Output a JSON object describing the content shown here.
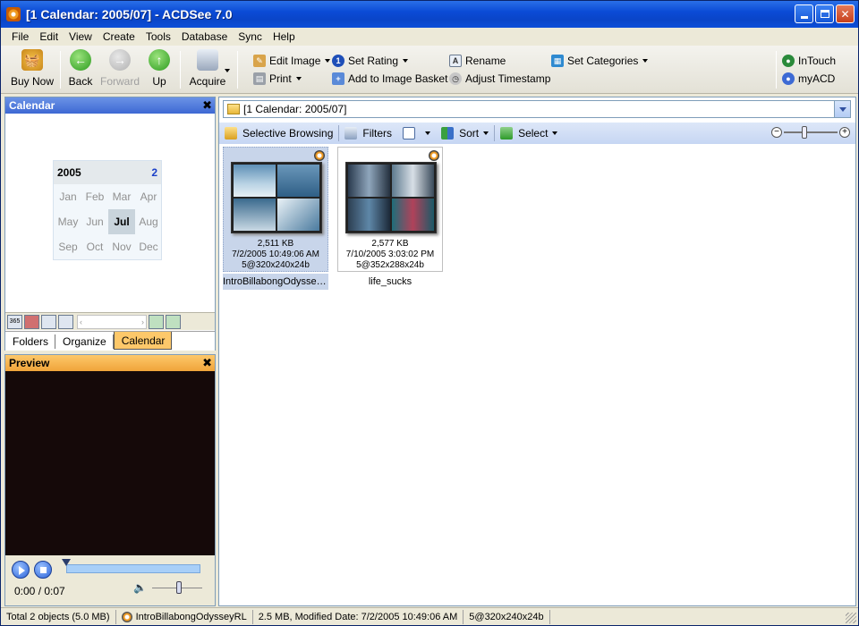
{
  "window": {
    "title": "[1 Calendar: 2005/07] - ACDSee 7.0"
  },
  "menu": [
    {
      "label": "File",
      "key": "F"
    },
    {
      "label": "Edit",
      "key": "E"
    },
    {
      "label": "View",
      "key": "V"
    },
    {
      "label": "Create",
      "key": "C"
    },
    {
      "label": "Tools",
      "key": "T"
    },
    {
      "label": "Database",
      "key": "D"
    },
    {
      "label": "Sync",
      "key": "S"
    },
    {
      "label": "Help",
      "key": "H"
    }
  ],
  "toolbar": {
    "buy_now": "Buy Now",
    "back": "Back",
    "forward": "Forward",
    "up": "Up",
    "acquire": "Acquire",
    "edit_image": "Edit Image",
    "print": "Print",
    "set_rating": "Set Rating",
    "add_to_basket": "Add to Image Basket",
    "rename": "Rename",
    "adjust_timestamp": "Adjust Timestamp",
    "set_categories": "Set Categories",
    "intouch": "InTouch",
    "myacd": "myACD"
  },
  "calendar_panel": {
    "title": "Calendar",
    "year": "2005",
    "count": "2",
    "months": [
      "Jan",
      "Feb",
      "Mar",
      "Apr",
      "May",
      "Jun",
      "Jul",
      "Aug",
      "Sep",
      "Oct",
      "Nov",
      "Dec"
    ],
    "active_month": "Jul",
    "mini_icon_365": "365"
  },
  "tabs": {
    "folders": "Folders",
    "organize": "Organize",
    "calendar": "Calendar"
  },
  "preview": {
    "title": "Preview",
    "time": "0:00 / 0:07",
    "progress": 0
  },
  "main": {
    "path": "[1 Calendar: 2005/07]",
    "selective_browsing": "Selective Browsing",
    "filters": "Filters",
    "sort": "Sort",
    "select": "Select",
    "files": [
      {
        "name": "IntroBillabongOdysseyRL",
        "size": "2,511 KB",
        "date": "7/2/2005 10:49:06 AM",
        "dims": "5@320x240x24b",
        "selected": true
      },
      {
        "name": "life_sucks",
        "size": "2,577 KB",
        "date": "7/10/2005 3:03:02 PM",
        "dims": "5@352x288x24b",
        "selected": false
      }
    ]
  },
  "status": {
    "total": "Total 2 objects  (5.0 MB)",
    "file": "IntroBillabongOdysseyRL",
    "info": "2.5 MB, Modified Date: 7/2/2005 10:49:06 AM",
    "dims": "5@320x240x24b"
  },
  "colors": {
    "titlebar": "#0b4bd6",
    "accent_tab": "#fdc86a",
    "selection": "#c8d5ea"
  }
}
